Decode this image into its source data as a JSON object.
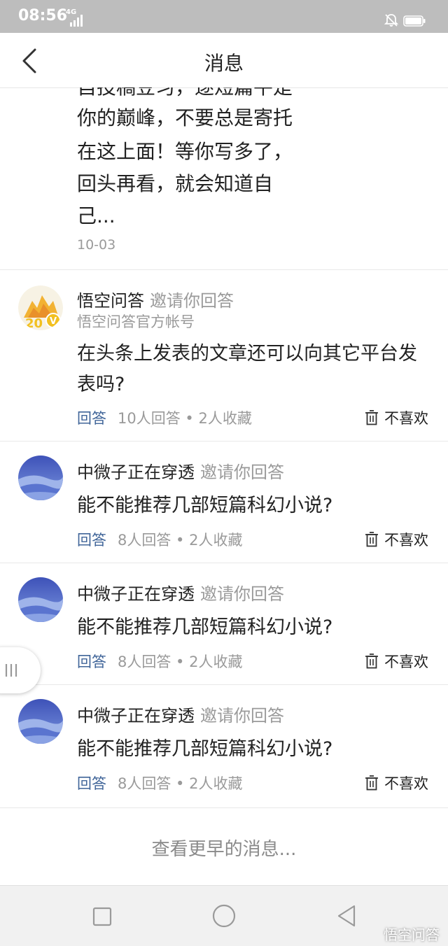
{
  "status_bar": {
    "time": "08:56",
    "network": "4G"
  },
  "header": {
    "title": "消息"
  },
  "partial_item": {
    "text_lines": [
      "自投稿豆习，逐短篇平是",
      "你的巅峰，不要总是寄托",
      "在这上面！等你写多了，",
      "回头再看，就会知道自",
      "己..."
    ],
    "date": "10-03"
  },
  "messages": [
    {
      "name": "悟空问答",
      "invite": "邀请你回答",
      "subtitle": "悟空问答官方帐号",
      "question": "在头条上发表的文章还可以向其它平台发表吗?",
      "answer_label": "回答",
      "stats": "10人回答 • 2人收藏",
      "dislike_label": "不喜欢"
    },
    {
      "name": "中微子正在穿透",
      "invite": "邀请你回答",
      "question": "能不能推荐几部短篇科幻小说?",
      "answer_label": "回答",
      "stats": "8人回答 • 2人收藏",
      "dislike_label": "不喜欢"
    },
    {
      "name": "中微子正在穿透",
      "invite": "邀请你回答",
      "question": "能不能推荐几部短篇科幻小说?",
      "answer_label": "回答",
      "stats": "8人回答 • 2人收藏",
      "dislike_label": "不喜欢"
    },
    {
      "name": "中微子正在穿透",
      "invite": "邀请你回答",
      "question": "能不能推荐几部短篇科幻小说?",
      "answer_label": "回答",
      "stats": "8人回答 • 2人收藏",
      "dislike_label": "不喜欢"
    }
  ],
  "more_messages": "查看更早的消息...",
  "watermark": "悟空问答",
  "colors": {
    "answer_link": "#406599",
    "muted_text": "#9a9a9a",
    "status_bar_bg": "#bdbdbd"
  },
  "icons": [
    "back-arrow-icon",
    "signal-icon",
    "bell-muted-icon",
    "battery-icon",
    "trash-icon",
    "menu-lines-icon",
    "nav-square-icon",
    "nav-circle-icon",
    "nav-back-triangle-icon"
  ]
}
